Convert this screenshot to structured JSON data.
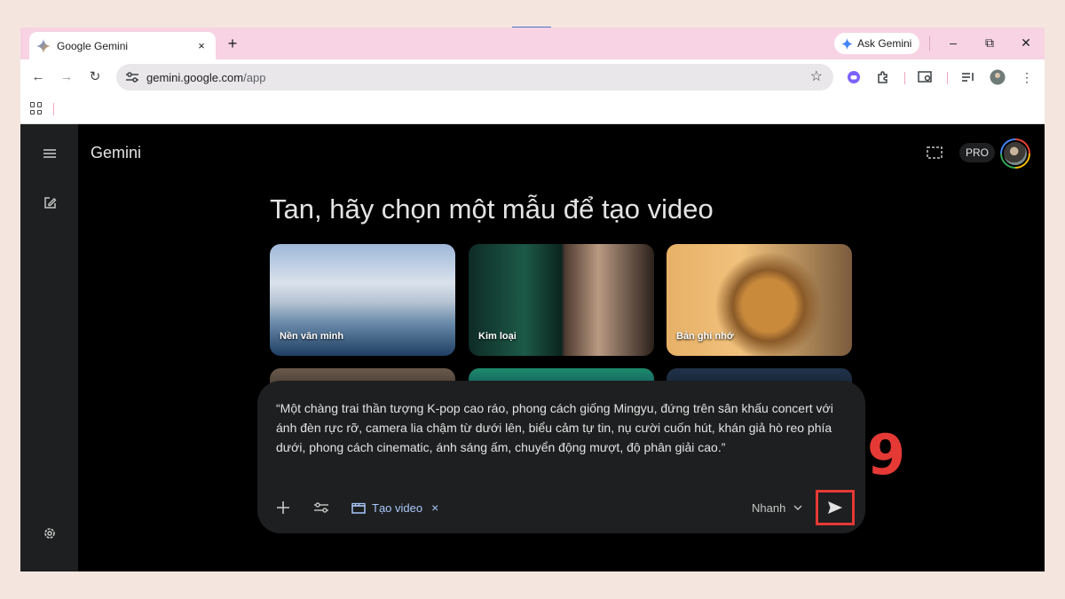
{
  "browser": {
    "tab_title": "Google Gemini",
    "tab_close": "×",
    "new_tab": "+",
    "ask_gemini": "Ask Gemini",
    "window_min": "–",
    "window_max": "⧉",
    "window_close": "✕",
    "url_domain": "gemini.google.com",
    "url_path": "/app"
  },
  "app": {
    "title": "Gemini",
    "pro_label": "PRO",
    "heading": "Tan, hãy chọn một mẫu để tạo video",
    "templates": [
      {
        "label": "Nền văn minh"
      },
      {
        "label": "Kim loại"
      },
      {
        "label": "Bản ghi nhớ"
      }
    ]
  },
  "prompt": {
    "text": "“Một chàng trai thần tượng K-pop cao ráo, phong cách giống Mingyu, đứng trên sân khấu concert với ánh đèn rực rỡ, camera lia chậm từ dưới lên, biểu cảm tự tin, nụ cười cuốn hút, khán giả hò reo phía dưới, phong cách cinematic, ánh sáng ấm, chuyển động mượt, độ phân giải cao.”",
    "tool_chip": "Tạo video",
    "tool_chip_remove": "×",
    "mode": "Nhanh"
  },
  "annotation": {
    "step": "9",
    "color": "#e53935"
  },
  "colors": {
    "accent_link": "#a8c7fa",
    "surface": "#1e1f20",
    "tabstrip": "#f7d3e3"
  }
}
